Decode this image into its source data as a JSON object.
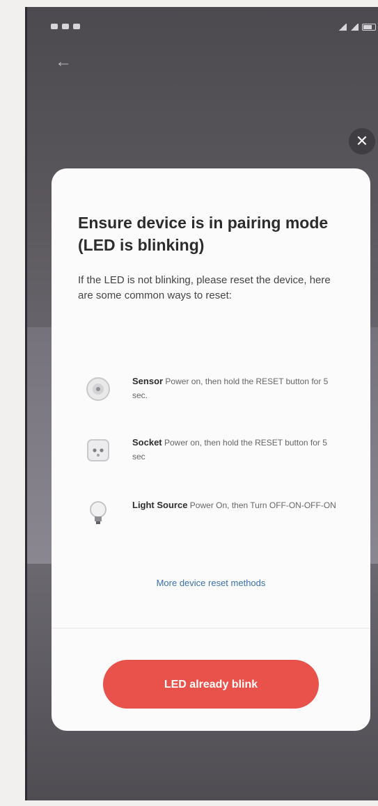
{
  "status_bar": {
    "battery_text": "🔋"
  },
  "dialog": {
    "title": "Ensure device is in pairing mode (LED is blinking)",
    "description": "If the LED is not blinking, please reset the device, here are some common ways to reset:",
    "methods": [
      {
        "name": "Sensor",
        "text": "Power on, then hold the RESET button for 5 sec.",
        "icon": "sensor-icon"
      },
      {
        "name": "Socket",
        "text": "Power on, then hold the RESET button for 5 sec",
        "icon": "socket-icon"
      },
      {
        "name": "Light Source",
        "text": "Power On, then Turn OFF-ON-OFF-ON",
        "icon": "bulb-icon"
      }
    ],
    "more_link": "More device reset methods",
    "confirm_button": "LED already blink",
    "close_icon": "close-icon"
  },
  "colors": {
    "accent": "#e8524b",
    "link": "#3b6fb0"
  }
}
